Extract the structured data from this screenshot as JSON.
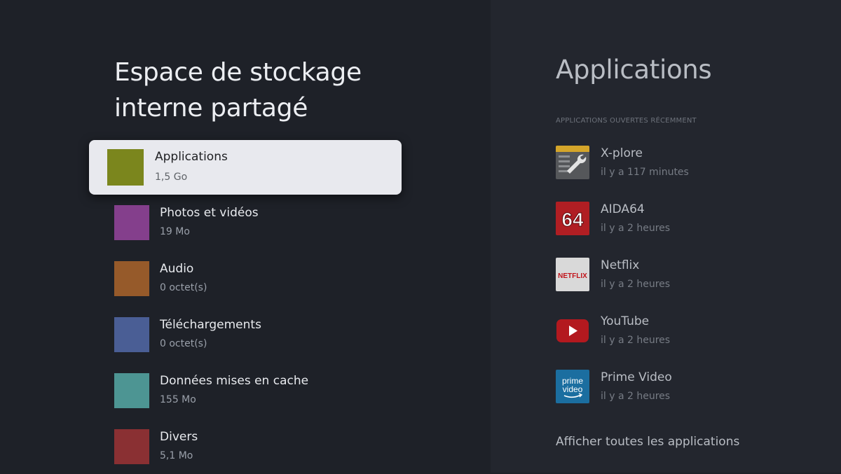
{
  "storage": {
    "title": "Espace de stockage interne partagé",
    "items": [
      {
        "label": "Applications",
        "size": "1,5 Go",
        "color": "#7b861d"
      },
      {
        "label": "Photos et vidéos",
        "size": "19 Mo",
        "color": "#843f8c"
      },
      {
        "label": "Audio",
        "size": "0 octet(s)",
        "color": "#965a2a"
      },
      {
        "label": "Téléchargements",
        "size": "0 octet(s)",
        "color": "#4a5e95"
      },
      {
        "label": "Données mises en cache",
        "size": "155 Mo",
        "color": "#4d9593"
      },
      {
        "label": "Divers",
        "size": "5,1 Mo",
        "color": "#8a3033"
      }
    ]
  },
  "apps": {
    "title": "Applications",
    "subheader": "APPLICATIONS OUVERTES RÉCEMMENT",
    "recent": [
      {
        "name": "X-plore",
        "time": "il y a 117 minutes",
        "icon": "xplore-icon"
      },
      {
        "name": "AIDA64",
        "time": "il y a 2 heures",
        "icon": "aida64-icon",
        "icon_text": "64"
      },
      {
        "name": "Netflix",
        "time": "il y a 2 heures",
        "icon": "netflix-icon",
        "icon_text": "NETFLIX"
      },
      {
        "name": "YouTube",
        "time": "il y a 2 heures",
        "icon": "youtube-icon"
      },
      {
        "name": "Prime Video",
        "time": "il y a 2 heures",
        "icon": "prime-video-icon",
        "icon_text_1": "prime",
        "icon_text_2": "video"
      }
    ],
    "see_all": "Afficher toutes les applications"
  }
}
